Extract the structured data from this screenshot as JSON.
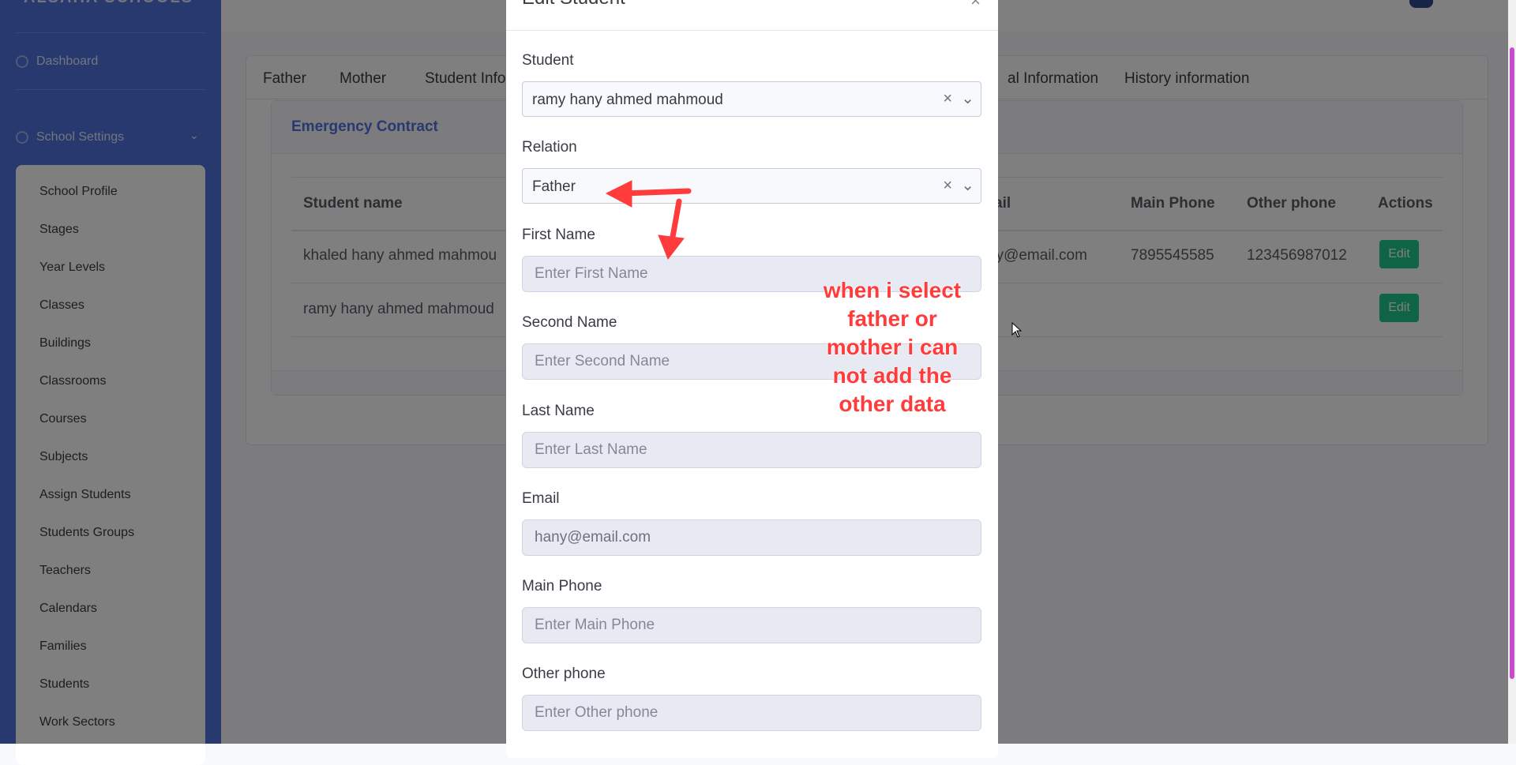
{
  "sidebar": {
    "brand": "ALSAHA SCHOOLS",
    "dashboard": "Dashboard",
    "settings": "School Settings",
    "items": [
      {
        "label": "School Profile"
      },
      {
        "label": "Stages"
      },
      {
        "label": "Year Levels"
      },
      {
        "label": "Classes"
      },
      {
        "label": "Buildings"
      },
      {
        "label": "Classrooms"
      },
      {
        "label": "Courses"
      },
      {
        "label": "Subjects"
      },
      {
        "label": "Assign Students"
      },
      {
        "label": "Students Groups"
      },
      {
        "label": "Teachers"
      },
      {
        "label": "Calendars"
      },
      {
        "label": "Families"
      },
      {
        "label": "Students"
      },
      {
        "label": "Work Sectors"
      }
    ]
  },
  "tabs": [
    "Father",
    "Mother",
    "Student Info",
    "al Information",
    "History information"
  ],
  "panel": {
    "title": "Emergency Contract",
    "columns": [
      "Student name",
      "ail",
      "Main Phone",
      "Other phone",
      "Actions"
    ],
    "rows": [
      {
        "name": "khaled hany ahmed mahmou",
        "email": "ay@email.com",
        "main_phone": "7895545585",
        "other_phone": "123456987012",
        "action": "Edit"
      },
      {
        "name": "ramy hany ahmed mahmoud",
        "email": "",
        "main_phone": "",
        "other_phone": "",
        "action": "Edit"
      }
    ]
  },
  "modal": {
    "title": "Edit Student",
    "student_label": "Student",
    "student_value": "ramy hany ahmed mahmoud",
    "relation_label": "Relation",
    "relation_value": "Father",
    "fields": [
      {
        "label": "First Name",
        "placeholder": "Enter First Name",
        "value": ""
      },
      {
        "label": "Second Name",
        "placeholder": "Enter Second Name",
        "value": ""
      },
      {
        "label": "Last Name",
        "placeholder": "Enter Last Name",
        "value": ""
      },
      {
        "label": "Email",
        "placeholder": "",
        "value": "hany@email.com"
      },
      {
        "label": "Main Phone",
        "placeholder": "Enter Main Phone",
        "value": ""
      },
      {
        "label": "Other phone",
        "placeholder": "Enter Other phone",
        "value": ""
      }
    ]
  },
  "annotation": {
    "text_lines": [
      "when i select",
      "father or",
      "mother i can",
      "not add the",
      "other data"
    ],
    "color": "#ff3b3b"
  },
  "colors": {
    "primary": "#4e73df",
    "success": "#1cc88a"
  }
}
